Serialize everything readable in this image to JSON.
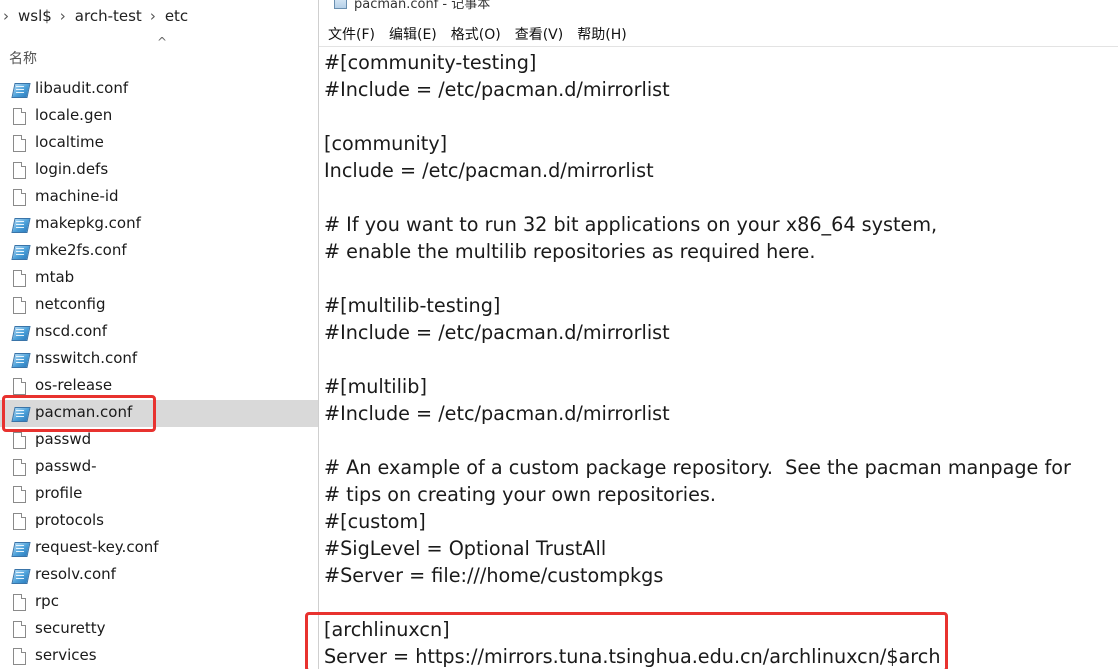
{
  "explorer": {
    "breadcrumb": [
      "wsl$",
      "arch-test",
      "etc"
    ],
    "column_name": "名称",
    "sort_indicator": "^",
    "files": [
      {
        "name": "libaudit.conf",
        "icon": "conf-file-icon"
      },
      {
        "name": "locale.gen",
        "icon": "document-icon"
      },
      {
        "name": "localtime",
        "icon": "document-icon"
      },
      {
        "name": "login.defs",
        "icon": "document-icon"
      },
      {
        "name": "machine-id",
        "icon": "document-icon"
      },
      {
        "name": "makepkg.conf",
        "icon": "conf-file-icon"
      },
      {
        "name": "mke2fs.conf",
        "icon": "conf-file-icon"
      },
      {
        "name": "mtab",
        "icon": "document-icon"
      },
      {
        "name": "netconfig",
        "icon": "document-icon"
      },
      {
        "name": "nscd.conf",
        "icon": "conf-file-icon"
      },
      {
        "name": "nsswitch.conf",
        "icon": "conf-file-icon"
      },
      {
        "name": "os-release",
        "icon": "document-icon"
      },
      {
        "name": "pacman.conf",
        "icon": "conf-file-icon",
        "selected": true
      },
      {
        "name": "passwd",
        "icon": "document-icon"
      },
      {
        "name": "passwd-",
        "icon": "document-icon"
      },
      {
        "name": "profile",
        "icon": "document-icon"
      },
      {
        "name": "protocols",
        "icon": "document-icon"
      },
      {
        "name": "request-key.conf",
        "icon": "conf-file-icon"
      },
      {
        "name": "resolv.conf",
        "icon": "conf-file-icon"
      },
      {
        "name": "rpc",
        "icon": "document-icon"
      },
      {
        "name": "securetty",
        "icon": "document-icon"
      },
      {
        "name": "services",
        "icon": "document-icon"
      }
    ]
  },
  "notepad": {
    "title": "pacman.conf - 记事本",
    "menu": [
      "文件(F)",
      "编辑(E)",
      "格式(O)",
      "查看(V)",
      "帮助(H)"
    ],
    "lines": [
      "#[community-testing]",
      "#Include = /etc/pacman.d/mirrorlist",
      "",
      "[community]",
      "Include = /etc/pacman.d/mirrorlist",
      "",
      "# If you want to run 32 bit applications on your x86_64 system,",
      "# enable the multilib repositories as required here.",
      "",
      "#[multilib-testing]",
      "#Include = /etc/pacman.d/mirrorlist",
      "",
      "#[multilib]",
      "#Include = /etc/pacman.d/mirrorlist",
      "",
      "# An example of a custom package repository.  See the pacman manpage for",
      "# tips on creating your own repositories.",
      "#[custom]",
      "#SigLevel = Optional TrustAll",
      "#Server = file:///home/custompkgs",
      "",
      "[archlinuxcn]",
      "Server = https://mirrors.tuna.tsinghua.edu.cn/archlinuxcn/$arch"
    ]
  },
  "colors": {
    "highlight": "#e8322f",
    "selected_row": "#d9d9d9"
  }
}
